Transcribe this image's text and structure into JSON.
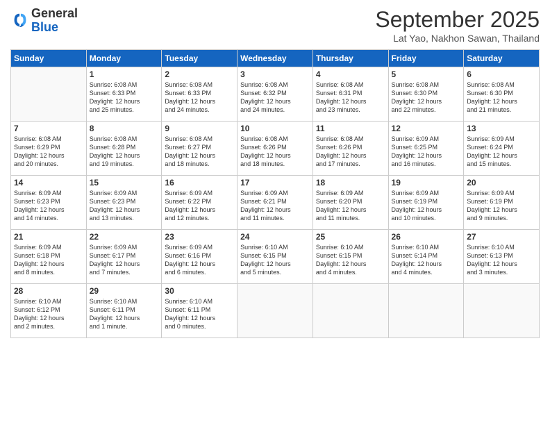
{
  "logo": {
    "general": "General",
    "blue": "Blue"
  },
  "title": "September 2025",
  "subtitle": "Lat Yao, Nakhon Sawan, Thailand",
  "days": [
    "Sunday",
    "Monday",
    "Tuesday",
    "Wednesday",
    "Thursday",
    "Friday",
    "Saturday"
  ],
  "weeks": [
    [
      {
        "day": "",
        "content": ""
      },
      {
        "day": "1",
        "content": "Sunrise: 6:08 AM\nSunset: 6:33 PM\nDaylight: 12 hours\nand 25 minutes."
      },
      {
        "day": "2",
        "content": "Sunrise: 6:08 AM\nSunset: 6:33 PM\nDaylight: 12 hours\nand 24 minutes."
      },
      {
        "day": "3",
        "content": "Sunrise: 6:08 AM\nSunset: 6:32 PM\nDaylight: 12 hours\nand 24 minutes."
      },
      {
        "day": "4",
        "content": "Sunrise: 6:08 AM\nSunset: 6:31 PM\nDaylight: 12 hours\nand 23 minutes."
      },
      {
        "day": "5",
        "content": "Sunrise: 6:08 AM\nSunset: 6:30 PM\nDaylight: 12 hours\nand 22 minutes."
      },
      {
        "day": "6",
        "content": "Sunrise: 6:08 AM\nSunset: 6:30 PM\nDaylight: 12 hours\nand 21 minutes."
      }
    ],
    [
      {
        "day": "7",
        "content": "Sunrise: 6:08 AM\nSunset: 6:29 PM\nDaylight: 12 hours\nand 20 minutes."
      },
      {
        "day": "8",
        "content": "Sunrise: 6:08 AM\nSunset: 6:28 PM\nDaylight: 12 hours\nand 19 minutes."
      },
      {
        "day": "9",
        "content": "Sunrise: 6:08 AM\nSunset: 6:27 PM\nDaylight: 12 hours\nand 18 minutes."
      },
      {
        "day": "10",
        "content": "Sunrise: 6:08 AM\nSunset: 6:26 PM\nDaylight: 12 hours\nand 18 minutes."
      },
      {
        "day": "11",
        "content": "Sunrise: 6:08 AM\nSunset: 6:26 PM\nDaylight: 12 hours\nand 17 minutes."
      },
      {
        "day": "12",
        "content": "Sunrise: 6:09 AM\nSunset: 6:25 PM\nDaylight: 12 hours\nand 16 minutes."
      },
      {
        "day": "13",
        "content": "Sunrise: 6:09 AM\nSunset: 6:24 PM\nDaylight: 12 hours\nand 15 minutes."
      }
    ],
    [
      {
        "day": "14",
        "content": "Sunrise: 6:09 AM\nSunset: 6:23 PM\nDaylight: 12 hours\nand 14 minutes."
      },
      {
        "day": "15",
        "content": "Sunrise: 6:09 AM\nSunset: 6:23 PM\nDaylight: 12 hours\nand 13 minutes."
      },
      {
        "day": "16",
        "content": "Sunrise: 6:09 AM\nSunset: 6:22 PM\nDaylight: 12 hours\nand 12 minutes."
      },
      {
        "day": "17",
        "content": "Sunrise: 6:09 AM\nSunset: 6:21 PM\nDaylight: 12 hours\nand 11 minutes."
      },
      {
        "day": "18",
        "content": "Sunrise: 6:09 AM\nSunset: 6:20 PM\nDaylight: 12 hours\nand 11 minutes."
      },
      {
        "day": "19",
        "content": "Sunrise: 6:09 AM\nSunset: 6:19 PM\nDaylight: 12 hours\nand 10 minutes."
      },
      {
        "day": "20",
        "content": "Sunrise: 6:09 AM\nSunset: 6:19 PM\nDaylight: 12 hours\nand 9 minutes."
      }
    ],
    [
      {
        "day": "21",
        "content": "Sunrise: 6:09 AM\nSunset: 6:18 PM\nDaylight: 12 hours\nand 8 minutes."
      },
      {
        "day": "22",
        "content": "Sunrise: 6:09 AM\nSunset: 6:17 PM\nDaylight: 12 hours\nand 7 minutes."
      },
      {
        "day": "23",
        "content": "Sunrise: 6:09 AM\nSunset: 6:16 PM\nDaylight: 12 hours\nand 6 minutes."
      },
      {
        "day": "24",
        "content": "Sunrise: 6:10 AM\nSunset: 6:15 PM\nDaylight: 12 hours\nand 5 minutes."
      },
      {
        "day": "25",
        "content": "Sunrise: 6:10 AM\nSunset: 6:15 PM\nDaylight: 12 hours\nand 4 minutes."
      },
      {
        "day": "26",
        "content": "Sunrise: 6:10 AM\nSunset: 6:14 PM\nDaylight: 12 hours\nand 4 minutes."
      },
      {
        "day": "27",
        "content": "Sunrise: 6:10 AM\nSunset: 6:13 PM\nDaylight: 12 hours\nand 3 minutes."
      }
    ],
    [
      {
        "day": "28",
        "content": "Sunrise: 6:10 AM\nSunset: 6:12 PM\nDaylight: 12 hours\nand 2 minutes."
      },
      {
        "day": "29",
        "content": "Sunrise: 6:10 AM\nSunset: 6:11 PM\nDaylight: 12 hours\nand 1 minute."
      },
      {
        "day": "30",
        "content": "Sunrise: 6:10 AM\nSunset: 6:11 PM\nDaylight: 12 hours\nand 0 minutes."
      },
      {
        "day": "",
        "content": ""
      },
      {
        "day": "",
        "content": ""
      },
      {
        "day": "",
        "content": ""
      },
      {
        "day": "",
        "content": ""
      }
    ]
  ]
}
